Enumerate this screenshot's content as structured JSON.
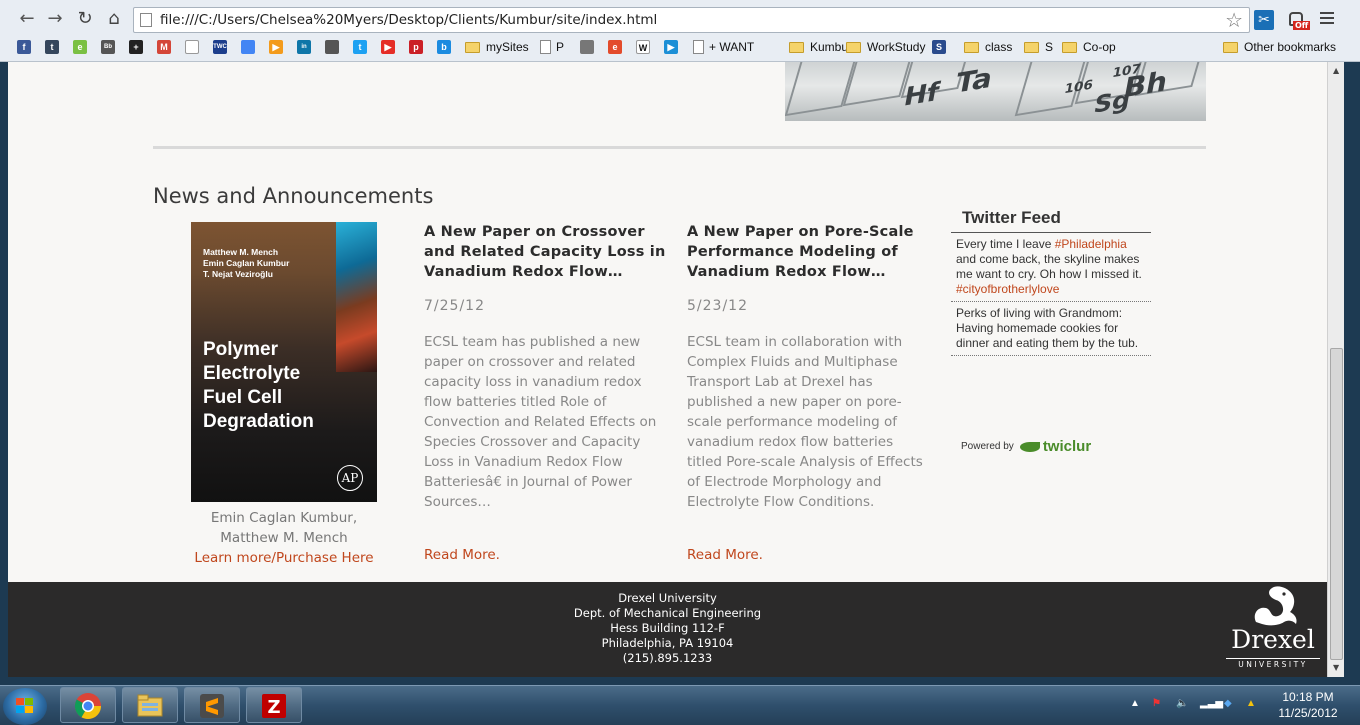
{
  "browser": {
    "url": "file:///C:/Users/Chelsea%20Myers/Desktop/Clients/Kumbur/site/index.html",
    "ext_badge": "Off",
    "bookmarks": [
      {
        "label": "",
        "icon": "facebook-icon",
        "color": "#3b5998",
        "glyph": "f"
      },
      {
        "label": "",
        "icon": "tumblr-icon",
        "color": "#35465c",
        "glyph": "t"
      },
      {
        "label": "",
        "icon": "evernote-icon",
        "color": "#7ac043",
        "glyph": "e"
      },
      {
        "label": "",
        "icon": "bb-icon",
        "color": "#555555",
        "glyph": "Bb"
      },
      {
        "label": "",
        "icon": "plus-icon",
        "color": "#222222",
        "glyph": "+"
      },
      {
        "label": "",
        "icon": "gmail-icon",
        "color": "#d44638",
        "glyph": "M"
      },
      {
        "label": "",
        "icon": "doc-icon",
        "color": "#ffffff",
        "glyph": ""
      },
      {
        "label": "",
        "icon": "twc-icon",
        "color": "#1c3e8c",
        "glyph": "TWC"
      },
      {
        "label": "",
        "icon": "google-docs-icon",
        "color": "#4285f4",
        "glyph": ""
      },
      {
        "label": "",
        "icon": "play-icon",
        "color": "#f39b1c",
        "glyph": "▶"
      },
      {
        "label": "",
        "icon": "linkedin-icon",
        "color": "#0e76a8",
        "glyph": "in"
      },
      {
        "label": "",
        "icon": "apple-icon",
        "color": "#555555",
        "glyph": ""
      },
      {
        "label": "",
        "icon": "twitter-icon",
        "color": "#1da1f2",
        "glyph": "t"
      },
      {
        "label": "",
        "icon": "youtube-icon",
        "color": "#e52d27",
        "glyph": "▶"
      },
      {
        "label": "",
        "icon": "pinterest-icon",
        "color": "#cb2027",
        "glyph": "p"
      },
      {
        "label": "",
        "icon": "b-icon",
        "color": "#1b8be0",
        "glyph": "b"
      },
      {
        "label": "mySites",
        "icon": "folder-icon"
      },
      {
        "label": "P",
        "icon": "doc-icon"
      },
      {
        "label": "",
        "icon": "grid-icon",
        "color": "#777777",
        "glyph": ""
      },
      {
        "label": "",
        "icon": "e-icon",
        "color": "#e34b2b",
        "glyph": "e"
      },
      {
        "label": "",
        "icon": "wikipedia-icon",
        "color": "#ffffff",
        "glyph": "W"
      },
      {
        "label": "",
        "icon": "video-icon",
        "color": "#1c8fd6",
        "glyph": "▶"
      },
      {
        "label": "+ WANT",
        "icon": "doc-icon"
      },
      {
        "label": "Kumbur",
        "icon": "folder-icon"
      },
      {
        "label": "WorkStudy",
        "icon": "folder-icon"
      },
      {
        "label": "",
        "icon": "s-icon",
        "color": "#2a4b8d",
        "glyph": "S"
      },
      {
        "label": "class",
        "icon": "folder-icon"
      },
      {
        "label": "S",
        "icon": "folder-icon"
      },
      {
        "label": "Co-op",
        "icon": "folder-icon"
      },
      {
        "label": "Other bookmarks",
        "icon": "folder-icon"
      }
    ]
  },
  "page": {
    "section_title": "News and Announcements",
    "book": {
      "authors": [
        "Matthew M. Mench",
        "Emin Caglan Kumbur",
        "T. Nejat Veziroğlu"
      ],
      "title_lines": [
        "Polymer",
        "Electrolyte",
        "Fuel Cell",
        "Degradation"
      ],
      "caption_lines": [
        "Emin Caglan Kumbur,",
        "Matthew M. Mench"
      ],
      "link": "Learn more/Purchase Here"
    },
    "news": [
      {
        "title": "A New Paper on Crossover and Related Capacity Loss in Vanadium Redox Flow…",
        "date": "7/25/12",
        "body": "ECSL team has published a new paper on crossover and related capacity loss in vanadium redox flow batteries titled Role of Convection and Related Effects on Species Crossover and Capacity Loss in Vanadium Redox Flow Batteriesâ€ in Journal of Power Sources…",
        "more": "Read More."
      },
      {
        "title": "A New Paper on Pore-Scale Performance Modeling of Vanadium Redox Flow…",
        "date": "5/23/12",
        "body": "ECSL team in collaboration with Complex Fluids and Multiphase Transport Lab at Drexel has published a new paper on pore-scale performance modeling of vanadium redox flow batteries titled Pore-scale Analysis of Effects of Electrode Morphology and Electrolyte Flow Conditions.",
        "more": "Read More."
      }
    ],
    "twitter": {
      "heading": "Twitter Feed",
      "tweets": [
        {
          "pre": "Every time I leave ",
          "tag1": "#Philadelphia",
          "mid": " and come back, the skyline makes me want to cry. Oh how I missed it. ",
          "tag2": "#cityofbrotherlylove"
        },
        {
          "pre": "Perks of living with Grandmom: Having homemade cookies for dinner and eating them by the tub.",
          "tag1": "",
          "mid": "",
          "tag2": ""
        }
      ],
      "powered_by": "Powered by",
      "brand": "twiclur"
    },
    "footer": {
      "lines": [
        "Drexel University",
        "Dept. of Mechanical Engineering",
        "Hess Building 112-F",
        "Philadelphia, PA 19104",
        "(215).895.1233"
      ],
      "logo_name": "Drexel",
      "logo_sub": "UNIVERSITY"
    }
  },
  "taskbar": {
    "time": "10:18 PM",
    "date": "11/25/2012",
    "apps": [
      "chrome-icon",
      "file-explorer-icon",
      "sublime-text-icon",
      "filezilla-icon"
    ]
  }
}
